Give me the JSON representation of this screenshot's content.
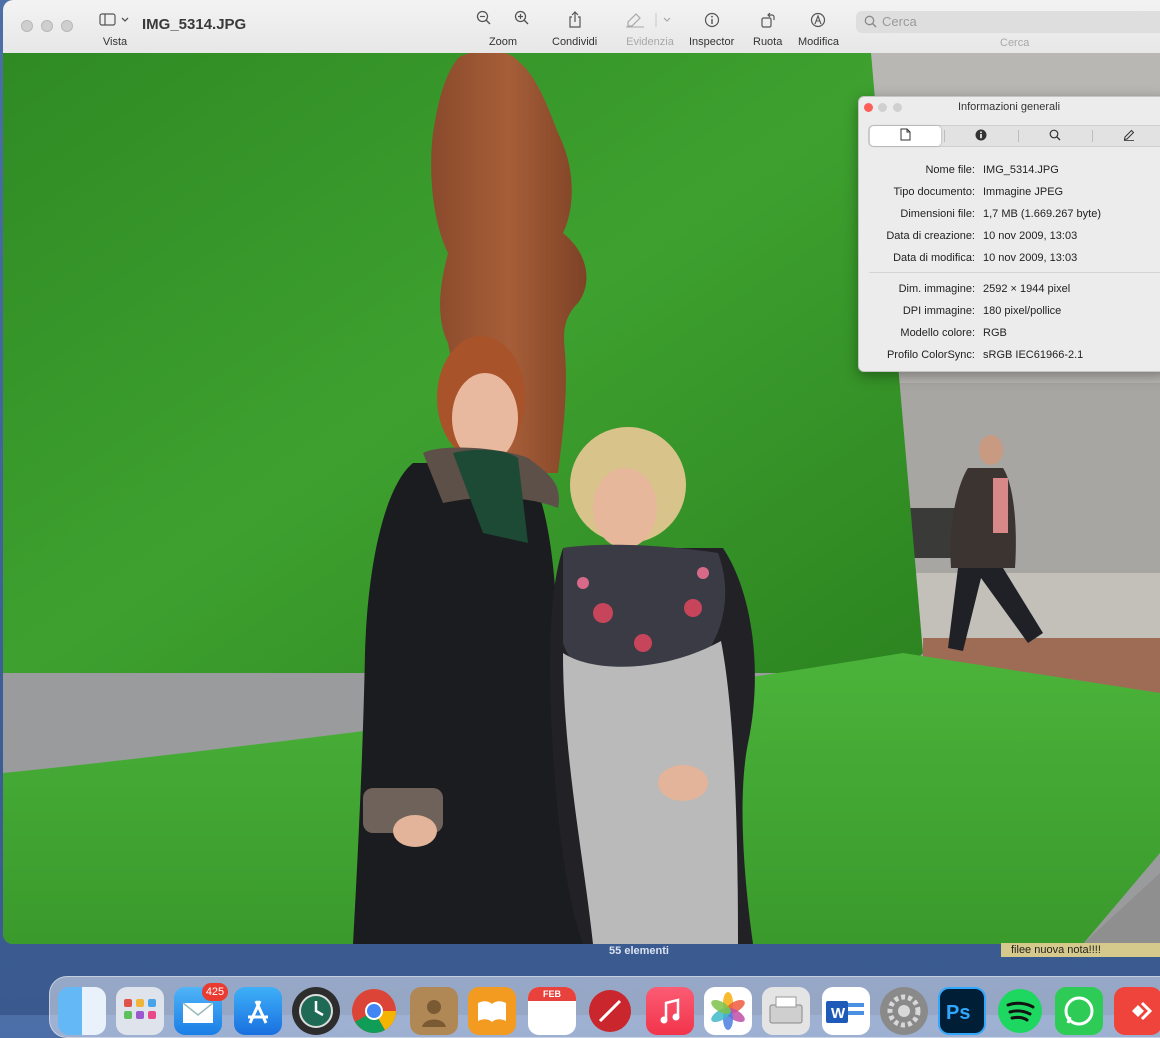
{
  "window": {
    "title": "IMG_5314.JPG",
    "toolbar": {
      "view_label": "Vista",
      "zoom_label": "Zoom",
      "share_label": "Condividi",
      "highlight_label": "Evidenzia",
      "inspector_label": "Inspector",
      "rotate_label": "Ruota",
      "edit_label": "Modifica",
      "search_placeholder": "Cerca",
      "search_label": "Cerca"
    }
  },
  "inspector": {
    "title": "Informazioni generali",
    "tabs": [
      "file-info-icon",
      "info-icon",
      "magnifier-icon",
      "pencil-icon"
    ],
    "rows": [
      {
        "key": "Nome file:",
        "value": "IMG_5314.JPG"
      },
      {
        "key": "Tipo documento:",
        "value": "Immagine JPEG"
      },
      {
        "key": "Dimensioni file:",
        "value": "1,7 MB (1.669.267 byte)"
      },
      {
        "key": "Data di creazione:",
        "value": "10 nov 2009, 13:03"
      },
      {
        "key": "Data di modifica:",
        "value": "10 nov 2009, 13:03"
      },
      {
        "key": "Dim. immagine:",
        "value": "2592 × 1944 pixel"
      },
      {
        "key": "DPI immagine:",
        "value": "180 pixel/pollice"
      },
      {
        "key": "Modello colore:",
        "value": "RGB"
      },
      {
        "key": "Profilo ColorSync:",
        "value": "sRGB IEC61966-2.1"
      }
    ]
  },
  "status": {
    "items_count": "55 elementi"
  },
  "note": {
    "text": "filee nuova nota!!!!"
  },
  "dock": {
    "mail_badge": "425",
    "calendar_month": "FEB",
    "apps": [
      "Finder",
      "Launchpad",
      "Mail",
      "App Store",
      "Time Machine",
      "Chrome",
      "Contatti",
      "Libri",
      "Calendario",
      "Scrivania",
      "Musica",
      "Foto",
      "Stampante",
      "Word",
      "Preferenze di Sistema",
      "Photoshop",
      "Spotify",
      "WhatsApp",
      "AnyDesk"
    ]
  },
  "colors": {
    "grass": "#3e9a2e",
    "close_red": "#fc5f57",
    "accent": "#0a64d8"
  }
}
